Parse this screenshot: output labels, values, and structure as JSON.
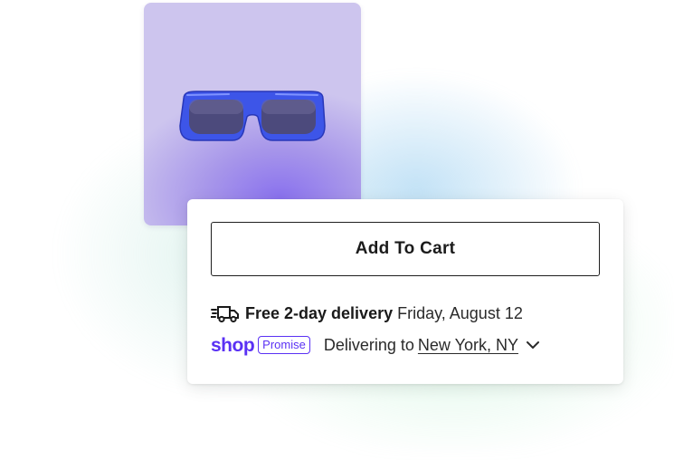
{
  "product": {
    "image_icon": "sunglasses-icon",
    "colors": {
      "frame": "#3d55e8",
      "lens": "#4a4a78",
      "background": "#cdc5ee"
    }
  },
  "cart": {
    "add_label": "Add To Cart"
  },
  "delivery": {
    "icon": "truck-icon",
    "headline": "Free 2-day delivery",
    "date": "Friday, August 12"
  },
  "shop_promise": {
    "logo": "shop",
    "badge": "Promise",
    "prefix": "Delivering to",
    "location": "New York, NY",
    "chevron_icon": "chevron-down-icon",
    "brand_color": "#5a31f4"
  }
}
